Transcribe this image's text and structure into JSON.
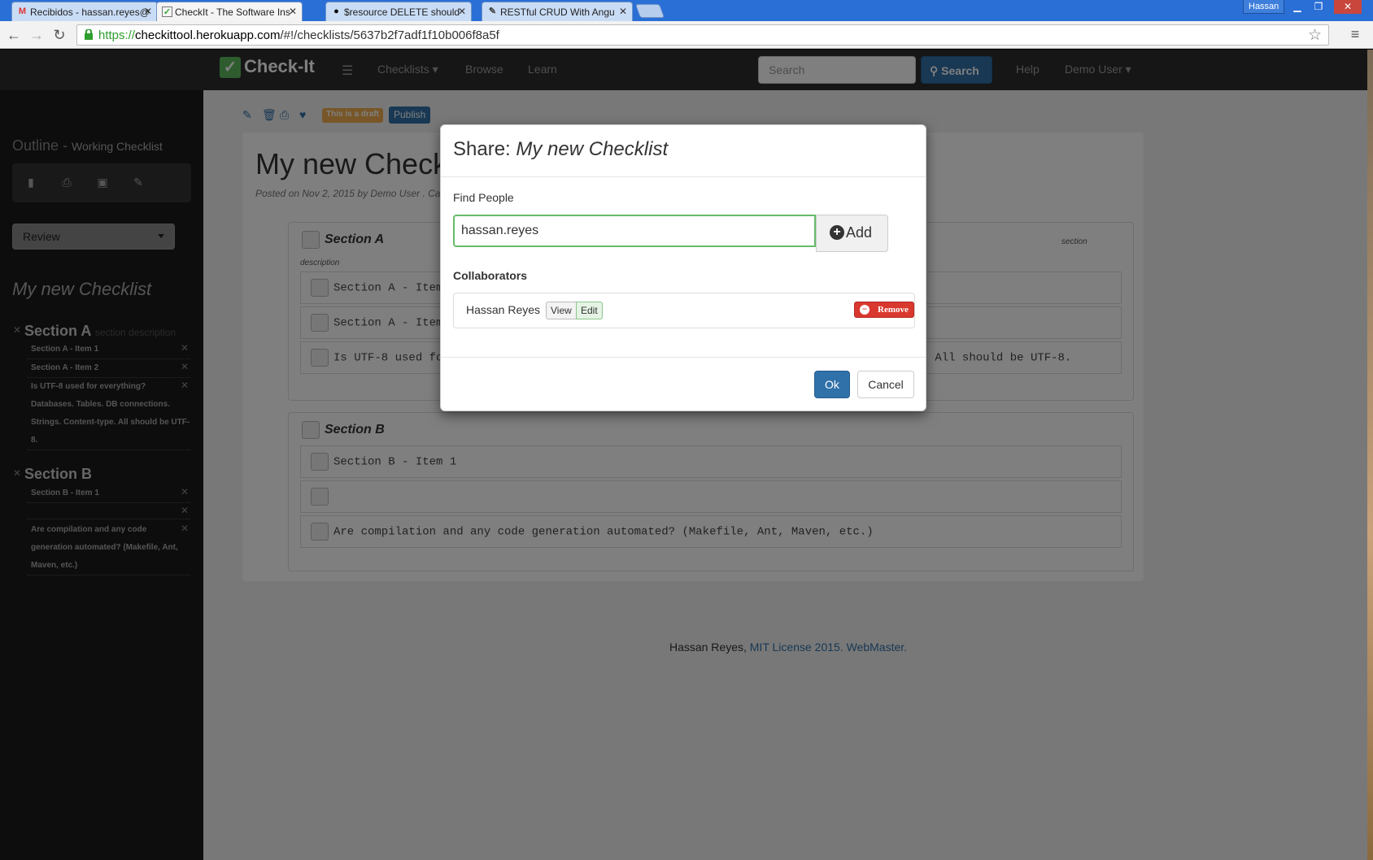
{
  "browser": {
    "tabs": [
      {
        "title": "Recibidos - hassan.reyes@",
        "icon": "gmail-icon"
      },
      {
        "title": "CheckIt - The Software Ins",
        "icon": "check-icon"
      },
      {
        "title": "$resource DELETE should",
        "icon": "github-icon"
      },
      {
        "title": "RESTful CRUD With Angu",
        "icon": "page-icon"
      }
    ],
    "profile": "Hassan",
    "url_host": "checkittool.herokuapp.com",
    "url_scheme": "https://",
    "url_path": "/#!/checklists/5637b2f7adf1f10b006f8a5f"
  },
  "navbar": {
    "brand": "Check-It",
    "checklists": "Checklists",
    "browse": "Browse",
    "learn": "Learn",
    "search_placeholder": "Search",
    "search_button": "Search",
    "help": "Help",
    "user": "Demo User"
  },
  "sidebar": {
    "outline": "Outline",
    "working": "Working Checklist",
    "review": "Review",
    "list_title": "My new Checklist",
    "sections": [
      {
        "name": "Section A",
        "desc": "section description",
        "items": [
          "Section A - Item 1",
          "Section A - Item 2",
          "Is UTF-8 used for everything? Databases. Tables. DB connections. Strings. Content-type. All should be UTF-8."
        ]
      },
      {
        "name": "Section B",
        "items": [
          "Section B - Item 1",
          "",
          "Are compilation and any code generation automated? (Makefile, Ant, Maven, etc.)"
        ]
      }
    ]
  },
  "main": {
    "draft": "This is a draft",
    "publish": "Publish",
    "title": "My new Check",
    "posted": "Posted on Nov 2, 2015 by Demo User . Ca",
    "section_a": {
      "name": "Section A",
      "desc_left": "description",
      "desc_right": "section",
      "items": [
        "Section A - Item",
        "Section A - Item",
        "Is UTF-8 used for everything? Databases. Tables. DB connections. Strings. Content-type. All should be UTF-8."
      ]
    },
    "section_b": {
      "name": "Section B",
      "items": [
        "Section B - Item 1",
        "",
        "Are compilation and any code generation automated? (Makefile, Ant, Maven, etc.)"
      ]
    },
    "footer_name": "Hassan Reyes,",
    "footer_link": "MIT License 2015. WebMaster."
  },
  "modal": {
    "title_prefix": "Share:",
    "title_name": "My new Checklist",
    "find_label": "Find People",
    "find_value": "hassan.reyes",
    "add": "Add",
    "collaborators_label": "Collaborators",
    "collaborator": {
      "name": "Hassan Reyes",
      "view": "View",
      "edit": "Edit",
      "permission": "Edit",
      "remove": "Remove"
    },
    "ok": "Ok",
    "cancel": "Cancel"
  },
  "colors": {
    "primary": "#3071a9",
    "danger": "#d9382e",
    "draft": "#f0ad4e",
    "success_border": "#66bb6a"
  }
}
